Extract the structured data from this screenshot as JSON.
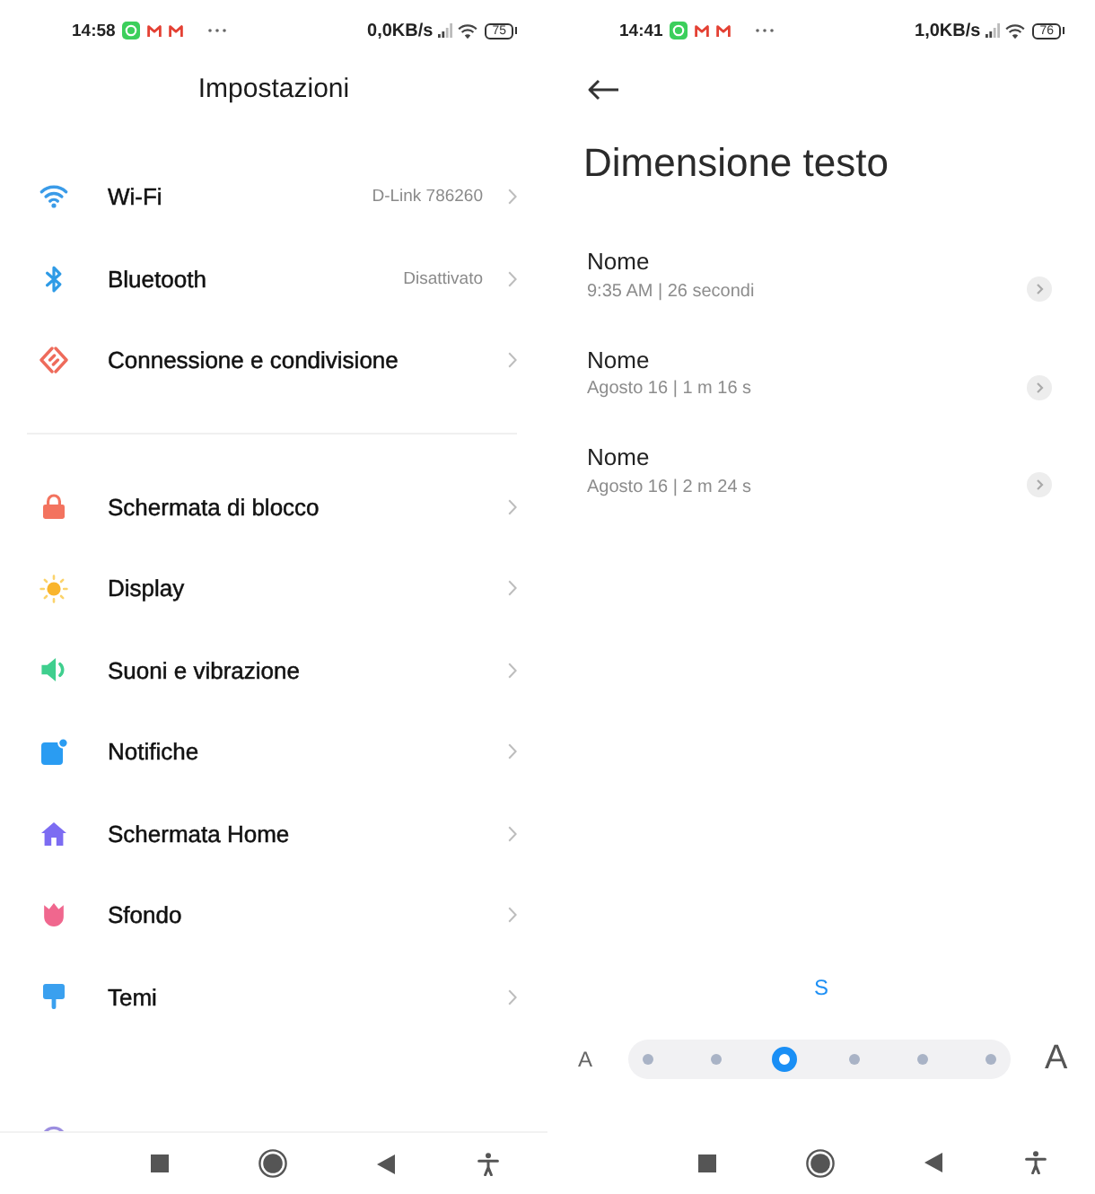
{
  "settings_screen": {
    "status_bar": {
      "time": "14:58",
      "speed": "0,0KB/s",
      "battery": "75"
    },
    "title": "Impostazioni",
    "sections": [
      {
        "items": [
          {
            "label": "Wi-Fi",
            "value": "D-Link 786260"
          },
          {
            "label": "Bluetooth",
            "value": "Disattivato"
          },
          {
            "label": "Connessione e condivisione"
          }
        ]
      },
      {
        "items": [
          {
            "label": "Schermata di blocco"
          },
          {
            "label": "Display"
          },
          {
            "label": "Suoni e vibrazione"
          },
          {
            "label": "Notifiche"
          },
          {
            "label": "Schermata Home"
          },
          {
            "label": "Sfondo"
          },
          {
            "label": "Temi"
          }
        ]
      }
    ]
  },
  "text_size_screen": {
    "status_bar": {
      "time": "14:41",
      "speed": "1,0KB/s",
      "battery": "76"
    },
    "title": "Dimensione testo",
    "items": [
      {
        "title": "Nome",
        "subtitle": "9:35 AM | 26 secondi"
      },
      {
        "title": "Nome",
        "subtitle": "Agosto 16 | 1 m 16 s"
      },
      {
        "title": "Nome",
        "subtitle": "Agosto 16 | 2 m 24 s"
      }
    ],
    "size_slider": {
      "label": "S",
      "small_label": "A",
      "large_label": "A",
      "stops": [
        {
          "selected": false
        },
        {
          "selected": false
        },
        {
          "selected": true
        },
        {
          "selected": false
        },
        {
          "selected": false
        },
        {
          "selected": false
        }
      ]
    }
  }
}
